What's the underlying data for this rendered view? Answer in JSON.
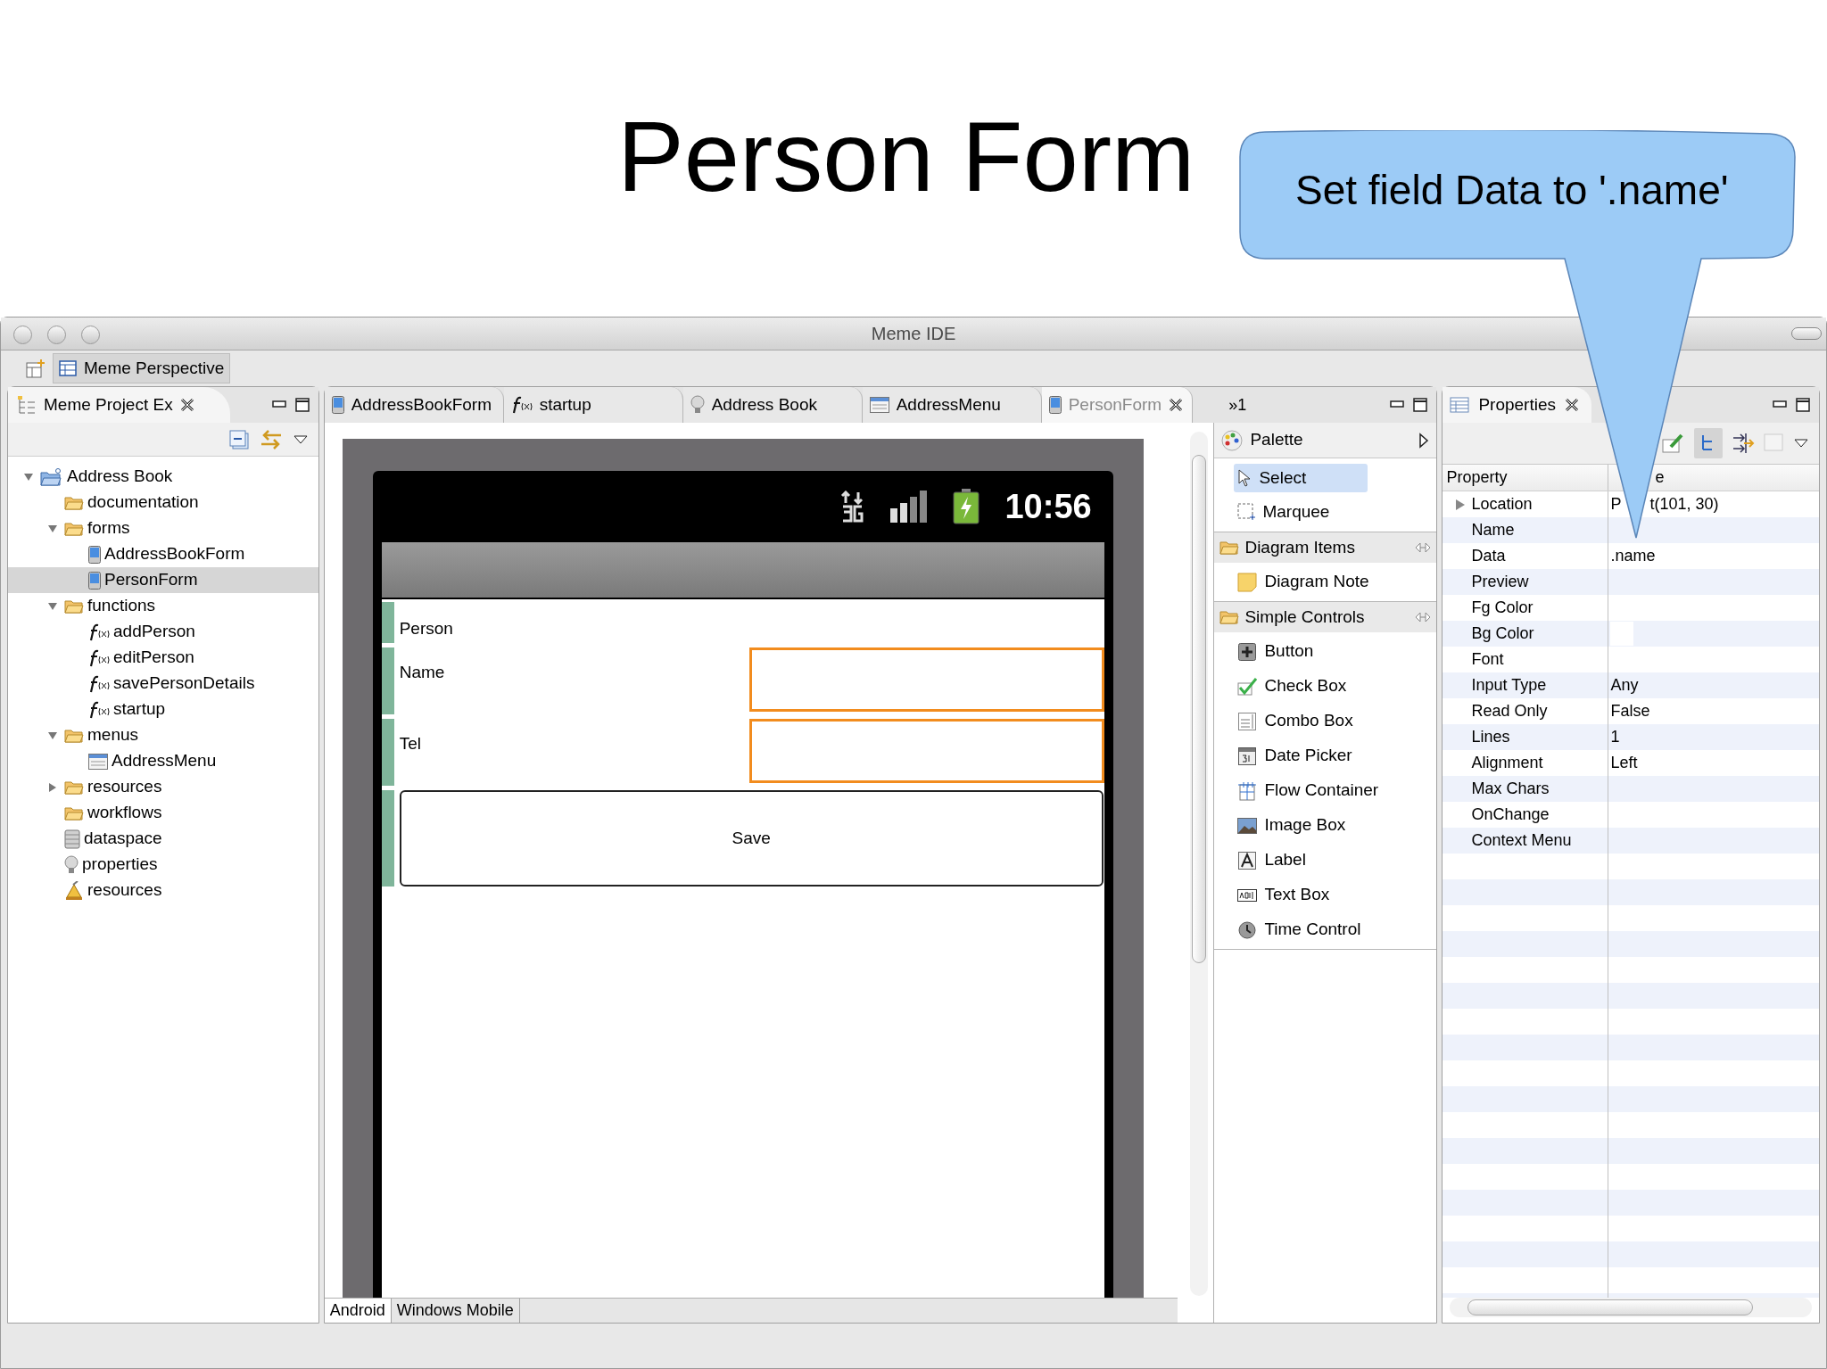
{
  "slide": {
    "title": "Person Form",
    "callout": "Set field Data to '.name'"
  },
  "window": {
    "title": "Meme IDE",
    "perspective": "Meme Perspective"
  },
  "project_explorer": {
    "title": "Meme Project Ex",
    "tree": [
      {
        "label": "Address Book",
        "kind": "project",
        "expanded": true,
        "selected": false,
        "children": [
          {
            "label": "documentation",
            "kind": "folder",
            "selected": false
          },
          {
            "label": "forms",
            "kind": "folder",
            "expanded": true,
            "selected": false,
            "children": [
              {
                "label": "AddressBookForm",
                "kind": "form",
                "selected": false
              },
              {
                "label": "PersonForm",
                "kind": "form",
                "selected": true
              }
            ]
          },
          {
            "label": "functions",
            "kind": "folder",
            "expanded": true,
            "selected": false,
            "children": [
              {
                "label": "addPerson",
                "kind": "function",
                "selected": false
              },
              {
                "label": "editPerson",
                "kind": "function",
                "selected": false
              },
              {
                "label": "savePersonDetails",
                "kind": "function",
                "selected": false
              },
              {
                "label": "startup",
                "kind": "function",
                "selected": false
              }
            ]
          },
          {
            "label": "menus",
            "kind": "folder",
            "expanded": true,
            "selected": false,
            "children": [
              {
                "label": "AddressMenu",
                "kind": "menu",
                "selected": false
              }
            ]
          },
          {
            "label": "resources",
            "kind": "folder",
            "expanded": false,
            "selected": false
          },
          {
            "label": "workflows",
            "kind": "folder",
            "selected": false
          },
          {
            "label": "dataspace",
            "kind": "database",
            "selected": false
          },
          {
            "label": "properties",
            "kind": "bulb",
            "selected": false
          },
          {
            "label": "resources",
            "kind": "flask",
            "selected": false
          }
        ]
      }
    ]
  },
  "editor": {
    "tabs": [
      {
        "label": "AddressBookForm",
        "kind": "form",
        "selected": false
      },
      {
        "label": "startup",
        "kind": "function",
        "selected": false
      },
      {
        "label": "Address Book",
        "kind": "bulb",
        "selected": false
      },
      {
        "label": "AddressMenu",
        "kind": "menu",
        "selected": false
      },
      {
        "label": "PersonForm",
        "kind": "form",
        "selected": true
      }
    ],
    "overflow": "»1",
    "phone": {
      "time": "10:56",
      "rows": [
        {
          "kind": "label",
          "text": "Person"
        },
        {
          "kind": "field",
          "text": "Name"
        },
        {
          "kind": "field",
          "text": "Tel"
        },
        {
          "kind": "button",
          "text": "Save"
        }
      ]
    },
    "bottom_tabs": [
      {
        "label": "Android",
        "selected": true
      },
      {
        "label": "Windows Mobile",
        "selected": false
      }
    ]
  },
  "palette": {
    "title": "Palette",
    "tools": [
      {
        "label": "Select",
        "kind": "select",
        "selected": true
      },
      {
        "label": "Marquee",
        "kind": "marquee",
        "selected": false
      }
    ],
    "groups": [
      {
        "title": "Diagram Items",
        "items": [
          {
            "label": "Diagram Note",
            "kind": "note"
          }
        ]
      },
      {
        "title": "Simple Controls",
        "items": [
          {
            "label": "Button",
            "kind": "button"
          },
          {
            "label": "Check Box",
            "kind": "check"
          },
          {
            "label": "Combo Box",
            "kind": "combo"
          },
          {
            "label": "Date Picker",
            "kind": "date"
          },
          {
            "label": "Flow Container",
            "kind": "flow"
          },
          {
            "label": "Image Box",
            "kind": "image"
          },
          {
            "label": "Label",
            "kind": "label"
          },
          {
            "label": "Text Box",
            "kind": "text"
          },
          {
            "label": "Time Control",
            "kind": "time"
          }
        ]
      }
    ]
  },
  "properties": {
    "title": "Properties",
    "columns": [
      "Property",
      "e"
    ],
    "rows": [
      {
        "property": "Location",
        "value": "P",
        "value_tail": "t(101, 30)",
        "expandable": true
      },
      {
        "property": "Name",
        "expandable": false
      },
      {
        "property": "Data",
        "value": ".name",
        "expandable": false
      },
      {
        "property": "Preview",
        "expandable": false
      },
      {
        "property": "Fg Color",
        "expandable": false
      },
      {
        "property": "Bg Color",
        "color": "#ffffff",
        "expandable": false
      },
      {
        "property": "Font",
        "expandable": false
      },
      {
        "property": "Input Type",
        "value": "Any",
        "expandable": false
      },
      {
        "property": "Read Only",
        "value": "False",
        "expandable": false
      },
      {
        "property": "Lines",
        "value": "1",
        "expandable": false
      },
      {
        "property": "Alignment",
        "value": "Left",
        "expandable": false
      },
      {
        "property": "Max Chars",
        "expandable": false
      },
      {
        "property": "OnChange",
        "expandable": false
      },
      {
        "property": "Context Menu",
        "expandable": false
      }
    ]
  }
}
